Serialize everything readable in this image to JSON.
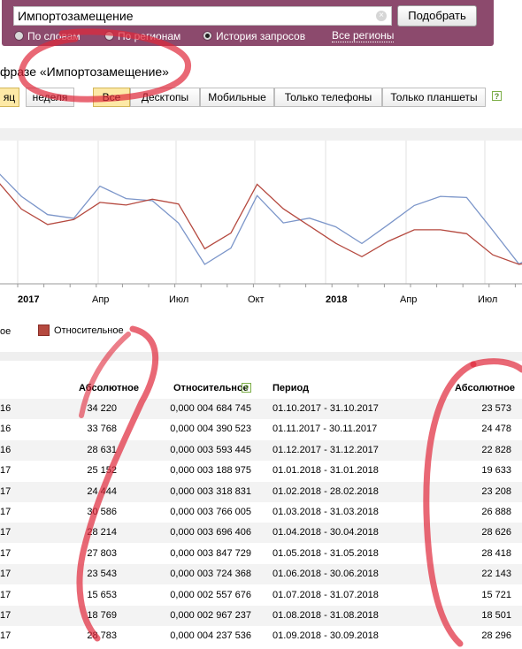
{
  "search": {
    "query": "Импортозамещение",
    "submit_label": "Подобрать",
    "clear_glyph": "×",
    "modes": [
      "По словам",
      "По регионам",
      "История запросов"
    ],
    "selected_mode": "История запросов",
    "regions_link": "Все регионы"
  },
  "heading": "фразе «Импортозамещение»",
  "period_buttons": [
    "яц",
    "неделя"
  ],
  "period_selected": "неделя",
  "device_buttons": [
    "Все",
    "Десктопы",
    "Мобильные",
    "Только телефоны",
    "Только планшеты"
  ],
  "device_selected": "Все",
  "help_glyph": "?",
  "chart_data": {
    "type": "line",
    "x_tick_labels": [
      "2017",
      "Апр",
      "Июл",
      "Окт",
      "2018",
      "Апр",
      "Июл"
    ],
    "series": [
      {
        "name": "Абсолютное",
        "color": "#7b95c9",
        "values": [
          34220,
          33768,
          28631,
          25152,
          24444,
          30586,
          28214,
          27803,
          23543,
          15653,
          18769,
          28783,
          23573,
          24478,
          22828,
          19633,
          23208,
          26888,
          28626,
          28418,
          22143,
          15721,
          18501,
          28296
        ]
      },
      {
        "name": "Относительное",
        "color": "#b5493f",
        "values": [
          4684745,
          4390523,
          3593445,
          3188975,
          3318831,
          3766005,
          3696406,
          3847729,
          3724368,
          2557676,
          2967237,
          4237536,
          3600000,
          3150000,
          2700000,
          2350000,
          2750000,
          3050000,
          3050000,
          2950000,
          2400000,
          2150000,
          2250000,
          3000000
        ]
      }
    ],
    "legend": {
      "absolute_tail": "ое",
      "relative": "Относительное"
    }
  },
  "table": {
    "headers": {
      "absolute": "Абсолютное",
      "relative": "Относительное",
      "period": "Период",
      "absolute_right": "Абсолютное"
    },
    "rows": [
      {
        "left_period": "16",
        "abs": "34 220",
        "rel": "0,000 004 684 745",
        "period": "01.10.2017 - 31.10.2017",
        "abs2": "23 573"
      },
      {
        "left_period": "16",
        "abs": "33 768",
        "rel": "0,000 004 390 523",
        "period": "01.11.2017 - 30.11.2017",
        "abs2": "24 478"
      },
      {
        "left_period": "16",
        "abs": "28 631",
        "rel": "0,000 003 593 445",
        "period": "01.12.2017 - 31.12.2017",
        "abs2": "22 828"
      },
      {
        "left_period": "17",
        "abs": "25 152",
        "rel": "0,000 003 188 975",
        "period": "01.01.2018 - 31.01.2018",
        "abs2": "19 633"
      },
      {
        "left_period": "17",
        "abs": "24 444",
        "rel": "0,000 003 318 831",
        "period": "01.02.2018 - 28.02.2018",
        "abs2": "23 208"
      },
      {
        "left_period": "17",
        "abs": "30 586",
        "rel": "0,000 003 766 005",
        "period": "01.03.2018 - 31.03.2018",
        "abs2": "26 888"
      },
      {
        "left_period": "17",
        "abs": "28 214",
        "rel": "0,000 003 696 406",
        "period": "01.04.2018 - 30.04.2018",
        "abs2": "28 626"
      },
      {
        "left_period": "17",
        "abs": "27 803",
        "rel": "0,000 003 847 729",
        "period": "01.05.2018 - 31.05.2018",
        "abs2": "28 418"
      },
      {
        "left_period": "17",
        "abs": "23 543",
        "rel": "0,000 003 724 368",
        "period": "01.06.2018 - 30.06.2018",
        "abs2": "22 143"
      },
      {
        "left_period": "17",
        "abs": "15 653",
        "rel": "0,000 002 557 676",
        "period": "01.07.2018 - 31.07.2018",
        "abs2": "15 721"
      },
      {
        "left_period": "17",
        "abs": "18 769",
        "rel": "0,000 002 967 237",
        "period": "01.08.2018 - 31.08.2018",
        "abs2": "18 501"
      },
      {
        "left_period": "17",
        "abs": "28 783",
        "rel": "0,000 004 237 536",
        "period": "01.09.2018 - 30.09.2018",
        "abs2": "28 296"
      }
    ]
  },
  "annotation_color": "#e0283a"
}
